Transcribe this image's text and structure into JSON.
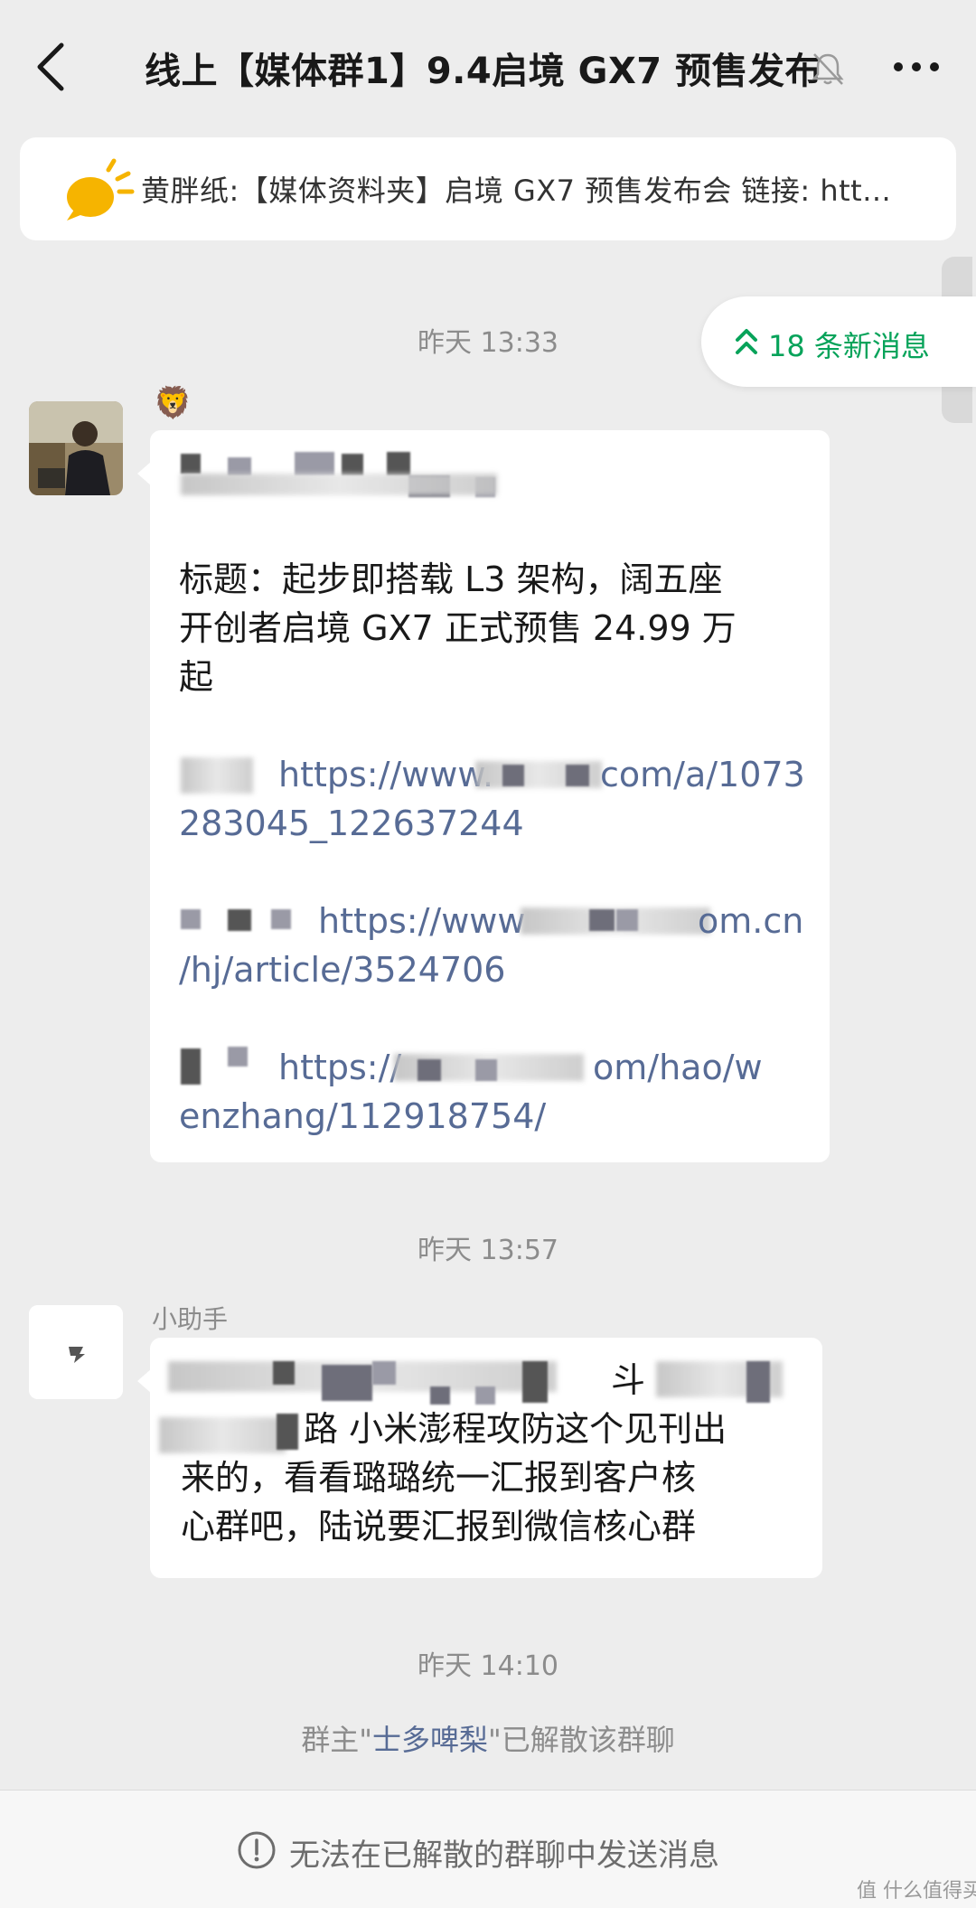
{
  "header": {
    "back_icon": "chevron-left-icon",
    "title": "线上【媒体群1】9.4启境 GX7 预售发布",
    "mute_icon": "bell-off-icon",
    "more_icon": "more-dots-icon"
  },
  "pinned": {
    "icon": "announcement-sun-icon",
    "text": "黄胖纸:【媒体资料夹】启境 GX7 预售发布会 链接: htt..."
  },
  "new_messages": {
    "icon": "double-chevron-up-icon",
    "label": "18 条新消息"
  },
  "timestamps": [
    "昨天 13:33",
    "昨天 13:57",
    "昨天 14:10"
  ],
  "messages": [
    {
      "sender_badge": "🦁",
      "lines": [
        "标题：起步即搭载 L3 架构，阔五座",
        "开创者启境 GX7 正式预售 24.99 万",
        "起"
      ],
      "links": [
        {
          "line1": "https://www.",
          "line1b": "com/a/1073",
          "line2": "283045_122637244"
        },
        {
          "line1": "https://www",
          "line1b": "om.cn",
          "line2": "/hj/article/3524706"
        },
        {
          "line1": "https://",
          "line1b": "om/hao/w",
          "line2": "enzhang/112918754/"
        }
      ]
    },
    {
      "sender": "小助手",
      "lines": [
        "斗",
        "路 小米澎程攻防这个见刊出",
        "来的，看看璐璐统一汇报到客户核",
        "心群吧，陆说要汇报到微信核心群"
      ]
    }
  ],
  "system_note": {
    "prefix": "群主\"",
    "owner": "士多啤梨",
    "suffix": "\"已解散该群聊"
  },
  "footer": {
    "icon": "warning-circle-icon",
    "text": "无法在已解散的群聊中发送消息"
  },
  "watermark": "值 什么值得买"
}
